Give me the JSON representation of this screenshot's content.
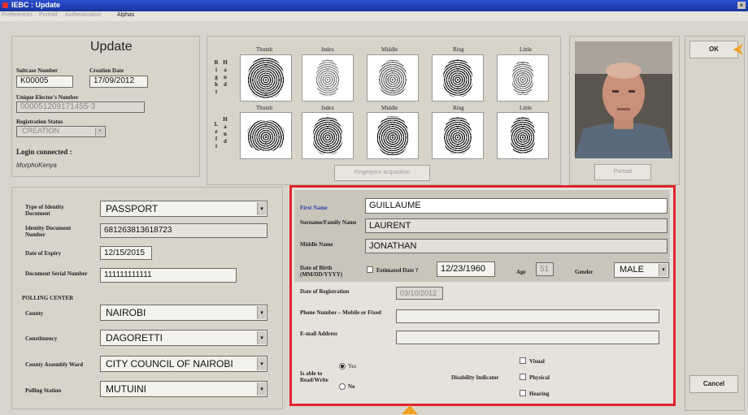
{
  "window": {
    "title": "IEBC : Update"
  },
  "menu": [
    "Preferences",
    "Portrait",
    "Authentication",
    "Alphas"
  ],
  "header": {
    "title": "Update",
    "suitcase_label": "Suitcase Number",
    "suitcase_value": "K00005",
    "creation_label": "Creation Date",
    "creation_value": "17/09/2012",
    "uen_label": "Unique Elector's Number",
    "uen_value": "000051209171455-3",
    "reg_status_label": "Registration Status",
    "reg_status_value": "CREATION",
    "login_label": "Login connected :",
    "login_value": "MorphoKenya"
  },
  "fingerprints": {
    "right_hand_letters": [
      "R",
      "i",
      "g",
      "h",
      "t"
    ],
    "hand_letters": [
      "H",
      "a",
      "n",
      "d"
    ],
    "left_hand_letters": [
      "L",
      "e",
      "f",
      "t"
    ],
    "fingers": [
      "Thumb",
      "Index",
      "Middle",
      "Ring",
      "Little"
    ],
    "acquisition_button": "Fingerprint acquisition"
  },
  "portrait": {
    "button": "Portrait"
  },
  "actions": {
    "ok": "OK",
    "cancel": "Cancel"
  },
  "identity": {
    "type_label": "Type of Identity Document",
    "type_value": "PASSPORT",
    "doc_number_label": "Identity Document Number",
    "doc_number_value": "681263813618723",
    "expiry_label": "Date of Expiry",
    "expiry_value": "12/15/2015",
    "serial_label": "Document Serial Number",
    "serial_value": "111111111111",
    "polling_center": "POLLING CENTER",
    "county_label": "County",
    "county_value": "NAIROBI",
    "constituency_label": "Constituency",
    "constituency_value": "DAGORETTI",
    "ward_label": "County Assembly Ward",
    "ward_value": "CITY COUNCIL OF NAIROBI",
    "station_label": "Polling Station",
    "station_value": "MUTUINI"
  },
  "person": {
    "first_name_label": "First Name",
    "first_name_value": "GUILLAUME",
    "surname_label": "Surname/Family Name",
    "surname_value": "LAURENT",
    "middle_label": "Middle Name",
    "middle_value": "JONATHAN",
    "dob_label": "Date of Birth (MM/DD/YYYY)",
    "estimated_label": "Estimated Date ?",
    "dob_value": "12/23/1960",
    "age_label": "Age",
    "age_value": "51",
    "gender_label": "Gender",
    "gender_value": "MALE",
    "reg_date_label": "Date of Registration",
    "reg_date_value": "03/10/2012",
    "phone_label": "Phone Number – Mobile or Fixed",
    "phone_value": "",
    "email_label": "E-mail Address",
    "email_value": "",
    "readwrite_label": "Is able to Read/Write",
    "yes_label": "Yes",
    "no_label": "No",
    "disability_label": "Disability Indicator",
    "visual_label": "Visual",
    "physical_label": "Physical",
    "hearing_label": "Hearing"
  },
  "colors": {
    "highlight": "#e0242c",
    "arrow": "#f0a020",
    "first_name_label": "#2a3fa8"
  }
}
